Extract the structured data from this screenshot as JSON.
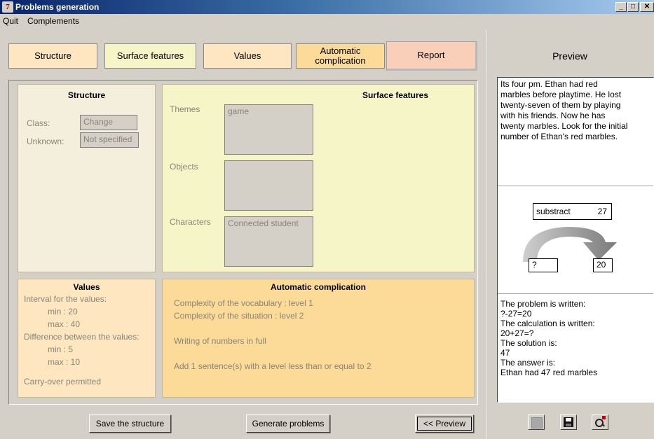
{
  "window": {
    "title": "Problems generation",
    "icon": "7"
  },
  "menu": {
    "quit": "Quit",
    "complements": "Complements"
  },
  "tabs": {
    "structure": "Structure",
    "surface": "Surface features",
    "values": "Values",
    "auto_line1": "Automatic",
    "auto_line2": "complication",
    "report": "Report"
  },
  "structure": {
    "title": "Structure",
    "class_label": "Class:",
    "class_value": "Change",
    "unknown_label": "Unknown:",
    "unknown_value": "Not specified"
  },
  "surface": {
    "title": "Surface features",
    "themes_label": "Themes",
    "themes_value": "game",
    "objects_label": "Objects",
    "objects_value": "",
    "characters_label": "Characters",
    "characters_value": "Connected student"
  },
  "values": {
    "title": "Values",
    "interval_label": "Interval for the values:",
    "min1": "min : 20",
    "max1": "max : 40",
    "difference_label": "Difference between the values:",
    "min2": "min : 5",
    "max2": "max : 10",
    "carry": "Carry-over permitted"
  },
  "auto": {
    "title": "Automatic complication",
    "vocab": "Complexity of the vocabulary : level 1",
    "situation": "Complexity of the situation : level 2",
    "numbers": "Writing of numbers in full",
    "sentences": "Add 1 sentence(s) with a level less than or equal to 2"
  },
  "buttons": {
    "save": "Save the structure",
    "generate": "Generate problems",
    "preview": "<< Preview"
  },
  "preview": {
    "title": "Preview",
    "problem_lines": [
      "Its four pm. Ethan had red",
      "marbles before playtime. He lost",
      "twenty-seven of them by playing",
      "with his friends. Now he has",
      "twenty marbles. Look for the initial",
      "number of Ethan's red marbles."
    ],
    "diagram": {
      "operation": "substract",
      "operand": "27",
      "start": "?",
      "end": "20"
    },
    "solution_lines": [
      "The problem is written:",
      "?-27=20",
      "The calculation is written:",
      "20+27=?",
      "The solution is:",
      "47",
      "The answer is:",
      "Ethan had 47 red marbles"
    ]
  },
  "colors": {
    "structure_bg": "#f4eedc",
    "surface_bg": "#f6f5c8",
    "values_bg": "#fde6c0",
    "auto_bg": "#fcda98",
    "report_bg": "#f9cfba"
  }
}
